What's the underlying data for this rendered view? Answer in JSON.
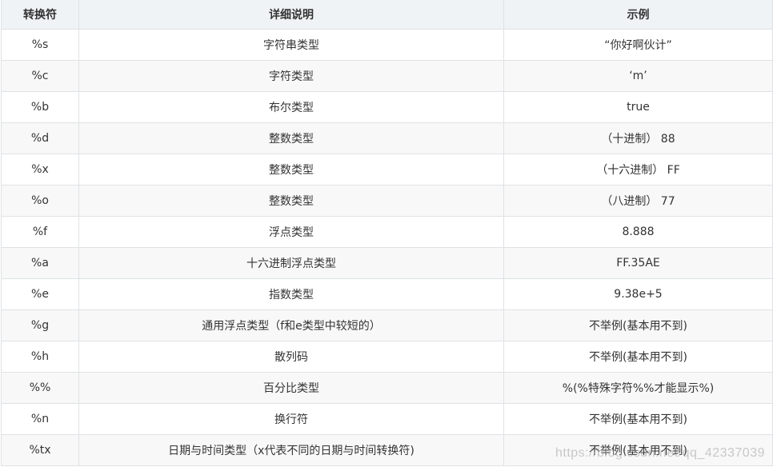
{
  "table": {
    "headers": [
      "转换符",
      "详细说明",
      "示例"
    ],
    "rows": [
      [
        "%s",
        "字符串类型",
        "“你好啊伙计”"
      ],
      [
        "%c",
        "字符类型",
        "‘m’"
      ],
      [
        "%b",
        "布尔类型",
        "true"
      ],
      [
        "%d",
        "整数类型",
        "（十进制） 88"
      ],
      [
        "%x",
        "整数类型",
        "（十六进制） FF"
      ],
      [
        "%o",
        "整数类型",
        "（八进制） 77"
      ],
      [
        "%f",
        "浮点类型",
        "8.888"
      ],
      [
        "%a",
        "十六进制浮点类型",
        "FF.35AE"
      ],
      [
        "%e",
        "指数类型",
        "9.38e+5"
      ],
      [
        "%g",
        "通用浮点类型（f和e类型中较短的）",
        "不举例(基本用不到)"
      ],
      [
        "%h",
        "散列码",
        "不举例(基本用不到)"
      ],
      [
        "%%",
        "百分比类型",
        "%(%特殊字符%%才能显示%)"
      ],
      [
        "%n",
        "换行符",
        "不举例(基本用不到)"
      ],
      [
        "%tx",
        "日期与时间类型（x代表不同的日期与时间转换符)",
        "不举例(基本用不到)"
      ]
    ]
  },
  "watermark": "https://blog.csdn.net/qq_42337039"
}
